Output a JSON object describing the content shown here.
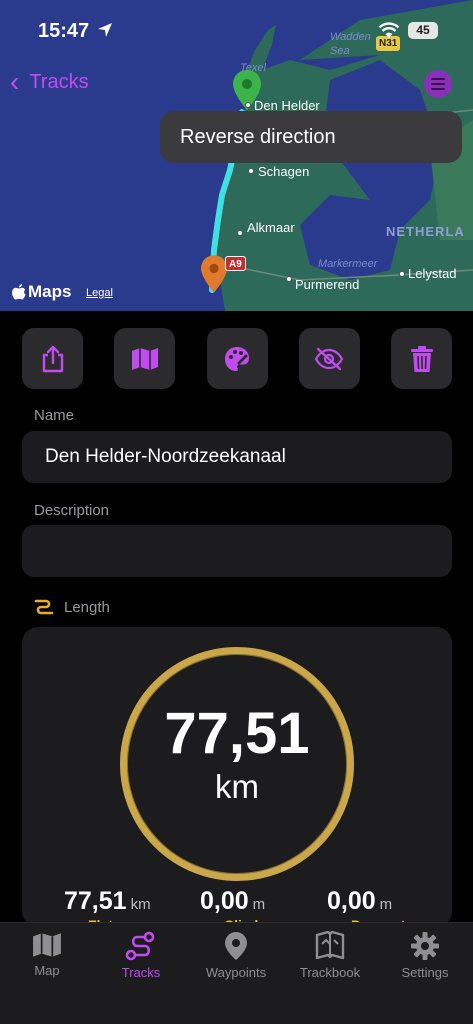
{
  "status": {
    "time": "15:47",
    "battery": "45"
  },
  "nav": {
    "back_label": "Tracks"
  },
  "tooltip": {
    "text": "Reverse direction"
  },
  "map": {
    "logo": "Maps",
    "legal": "Legal",
    "places": {
      "den_helder": "Den Helder",
      "schagen": "Schagen",
      "alkmaar": "Alkmaar",
      "purmerend": "Purmerend",
      "lelystad": "Lelystad",
      "texel": "Texel",
      "wadden_sea": "Wadden Sea",
      "markermeer": "Markermeer",
      "netherlands": "NETHERLA"
    },
    "road_shields": {
      "n31": "N31",
      "a9": "A9"
    },
    "colors": {
      "water": "#2a3a8c",
      "land": "#2e6a5a",
      "track": "#3fe0e0",
      "start_pin": "#3cb44b",
      "end_pin": "#e07a2e"
    }
  },
  "actions": [
    {
      "name": "share-button",
      "icon": "share-icon"
    },
    {
      "name": "map-button",
      "icon": "map-icon"
    },
    {
      "name": "style-button",
      "icon": "palette-icon"
    },
    {
      "name": "hide-button",
      "icon": "eye-slash-icon"
    },
    {
      "name": "delete-button",
      "icon": "trash-icon"
    }
  ],
  "form": {
    "name_label": "Name",
    "name_value": "Den Helder-Noordzeekanaal",
    "description_label": "Description",
    "description_value": ""
  },
  "length": {
    "label": "Length",
    "value": "77,51",
    "unit": "km",
    "stats": [
      {
        "value": "77,51",
        "unit": "km",
        "label": "Flat"
      },
      {
        "value": "0,00",
        "unit": "m",
        "label": "Climb"
      },
      {
        "value": "0,00",
        "unit": "m",
        "label": "Descent"
      }
    ]
  },
  "tabs": [
    {
      "label": "Map",
      "icon": "map-icon",
      "active": false
    },
    {
      "label": "Tracks",
      "icon": "route-icon",
      "active": true
    },
    {
      "label": "Waypoints",
      "icon": "pin-icon",
      "active": false
    },
    {
      "label": "Trackbook",
      "icon": "book-icon",
      "active": false
    },
    {
      "label": "Settings",
      "icon": "gear-icon",
      "active": false
    }
  ],
  "accent": "#c04cf0"
}
